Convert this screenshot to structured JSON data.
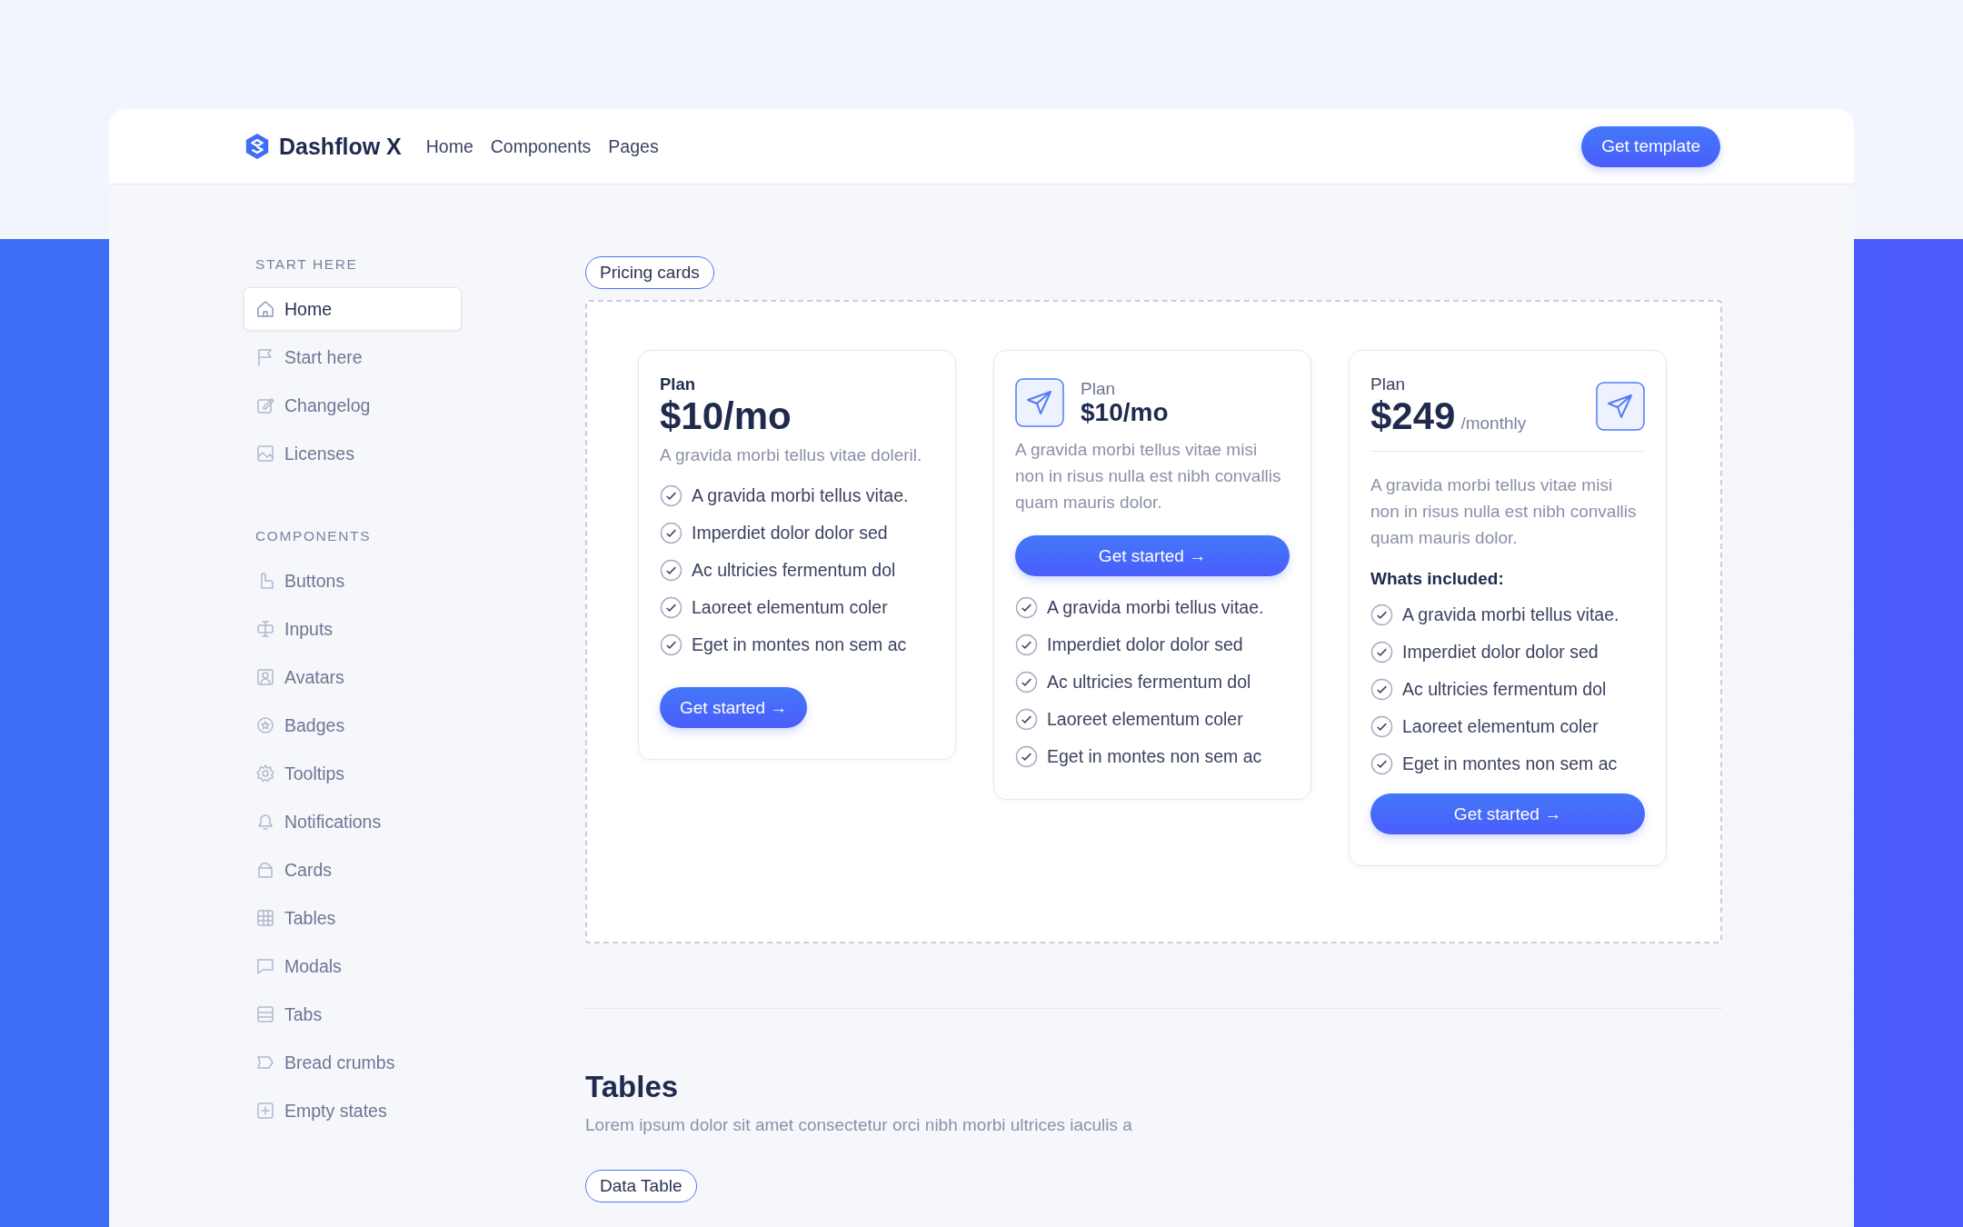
{
  "header": {
    "brand": "Dashflow X",
    "nav": [
      {
        "label": "Home"
      },
      {
        "label": "Components"
      },
      {
        "label": "Pages"
      }
    ],
    "cta": "Get template"
  },
  "sidebar": {
    "sections": [
      {
        "title": "START HERE",
        "items": [
          {
            "label": "Home",
            "selected": true
          },
          {
            "label": "Start here",
            "selected": false
          },
          {
            "label": "Changelog",
            "selected": false
          },
          {
            "label": "Licenses",
            "selected": false
          }
        ]
      },
      {
        "title": "COMPONENTS",
        "items": [
          {
            "label": "Buttons",
            "selected": false
          },
          {
            "label": "Inputs",
            "selected": false
          },
          {
            "label": "Avatars",
            "selected": false
          },
          {
            "label": "Badges",
            "selected": false
          },
          {
            "label": "Tooltips",
            "selected": false
          },
          {
            "label": "Notifications",
            "selected": false
          },
          {
            "label": "Cards",
            "selected": false
          },
          {
            "label": "Tables",
            "selected": false
          },
          {
            "label": "Modals",
            "selected": false
          },
          {
            "label": "Tabs",
            "selected": false
          },
          {
            "label": "Bread crumbs",
            "selected": false
          },
          {
            "label": "Empty states",
            "selected": false
          }
        ]
      }
    ]
  },
  "pricing": {
    "tag": "Pricing cards",
    "cards": [
      {
        "kind": "basic",
        "plan": "Plan",
        "price": "$10/mo",
        "description": "A gravida morbi tellus vitae doleril.",
        "features": [
          "A gravida morbi tellus vitae.",
          "Imperdiet dolor dolor sed",
          "Ac ultricies fermentum dol",
          "Laoreet elementum coler",
          "Eget in montes non sem ac"
        ],
        "button": "Get started →"
      },
      {
        "kind": "icon-top",
        "plan": "Plan",
        "price": "$10/mo",
        "description": "A gravida morbi tellus vitae misi non in risus nulla est nibh convallis quam mauris dolor.",
        "features": [
          "A gravida morbi tellus vitae.",
          "Imperdiet dolor dolor sed",
          "Ac ultricies fermentum dol",
          "Laoreet elementum coler",
          "Eget in montes non sem ac"
        ],
        "button": "Get started →"
      },
      {
        "kind": "icon-side",
        "plan": "Plan",
        "price": "$249",
        "period": "/monthly",
        "description": "A gravida morbi tellus vitae misi non in risus nulla est nibh convallis quam mauris dolor.",
        "included_heading": "Whats included:",
        "features": [
          "A gravida morbi tellus vitae.",
          "Imperdiet dolor dolor sed",
          "Ac ultricies fermentum dol",
          "Laoreet elementum coler",
          "Eget in montes non sem ac"
        ],
        "button": "Get started →"
      }
    ]
  },
  "tables": {
    "title": "Tables",
    "subtitle": "Lorem ipsum dolor sit amet consectetur orci nibh morbi ultrices iaculis a",
    "tag": "Data Table"
  }
}
